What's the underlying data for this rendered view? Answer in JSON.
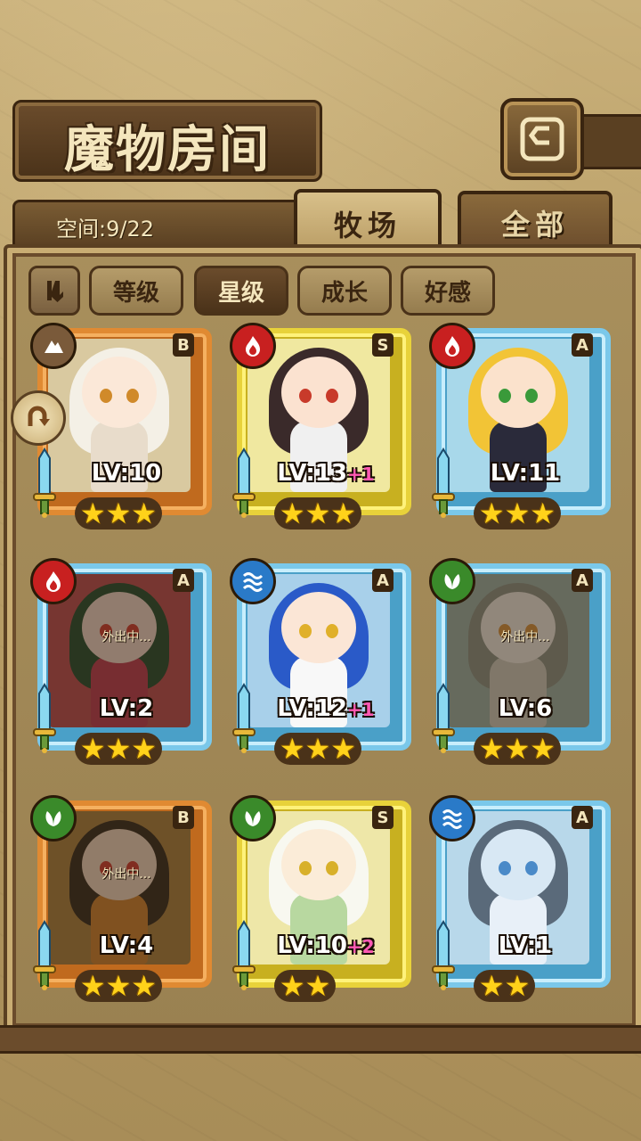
{
  "header": {
    "title": "魔物房间"
  },
  "capacity": {
    "text": "空间:9/22"
  },
  "tabs": [
    {
      "label": "牧场",
      "active": true
    },
    {
      "label": "全部",
      "active": false
    }
  ],
  "sort": {
    "toggle_icon": "pause-sort-icon",
    "buttons": [
      {
        "label": "等级",
        "active": false
      },
      {
        "label": "星级",
        "active": true
      },
      {
        "label": "成长",
        "active": false
      },
      {
        "label": "好感",
        "active": false
      }
    ]
  },
  "monsters": [
    {
      "rank": "B",
      "element": "earth",
      "level": "LV:10",
      "plus": "",
      "stars": 3,
      "away": ""
    },
    {
      "rank": "S",
      "element": "fire",
      "level": "LV:13",
      "plus": "+1",
      "stars": 3,
      "away": ""
    },
    {
      "rank": "A",
      "element": "fire",
      "level": "LV:11",
      "plus": "",
      "stars": 3,
      "away": ""
    },
    {
      "rank": "A",
      "element": "fire",
      "level": "LV:2",
      "plus": "",
      "stars": 3,
      "away": "外出中..."
    },
    {
      "rank": "A",
      "element": "water",
      "level": "LV:12",
      "plus": "+1",
      "stars": 3,
      "away": ""
    },
    {
      "rank": "A",
      "element": "leaf",
      "level": "LV:6",
      "plus": "",
      "stars": 3,
      "away": "外出中..."
    },
    {
      "rank": "B",
      "element": "leaf",
      "level": "LV:4",
      "plus": "",
      "stars": 3,
      "away": "外出中..."
    },
    {
      "rank": "S",
      "element": "leaf",
      "level": "LV:10",
      "plus": "+2",
      "stars": 2,
      "away": ""
    },
    {
      "rank": "A",
      "element": "water",
      "level": "LV:1",
      "plus": "",
      "stars": 2,
      "away": ""
    }
  ],
  "colors": {
    "frame_bronze": "#e08a32",
    "frame_gold": "#e8d23a",
    "frame_blue": "#7ac8ea",
    "plus_text": "#ff5ab4",
    "star": "#ffd21a"
  }
}
